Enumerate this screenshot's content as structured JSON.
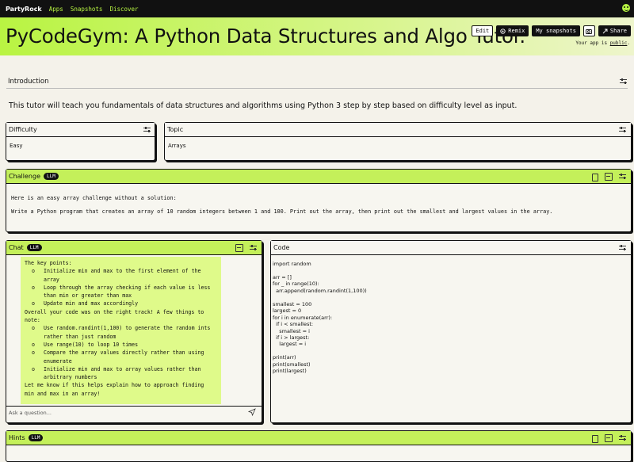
{
  "nav": {
    "brand": "PartyRock",
    "links": [
      "Apps",
      "Snapshots",
      "Discover"
    ]
  },
  "header": {
    "title": "PyCodeGym: A Python Data Structures and Algo Tutor.",
    "buttons": {
      "edit": "Edit",
      "remix": "Remix",
      "snapshots": "My snapshots",
      "share": "Share"
    },
    "public_prefix": "Your app is ",
    "public_link": "public",
    "public_suffix": "."
  },
  "intro": {
    "title": "Introduction",
    "text": "This tutor will teach you fundamentals of data structures and algorithms using Python 3 step by step based on difficulty level as input."
  },
  "difficulty": {
    "title": "Difficulty",
    "value": "Easy"
  },
  "topic": {
    "title": "Topic",
    "value": "Arrays"
  },
  "challenge": {
    "title": "Challenge",
    "badge": "LLM",
    "line1": "Here is an easy array challenge without a solution:",
    "line2": "Write a Python program that creates an array of 10 random integers between 1 and 100. Print out the array, then print out the smallest and largest values in the array."
  },
  "chat": {
    "title": "Chat",
    "badge": "LLM",
    "lines": [
      {
        "indent": 0,
        "text": "The key points:"
      },
      {
        "indent": 1,
        "bullet": "o",
        "text": "Initialize min and max to the first element of the"
      },
      {
        "indent": 2,
        "text": "array"
      },
      {
        "indent": 1,
        "bullet": "o",
        "text": "Loop through the array checking if each value is less"
      },
      {
        "indent": 2,
        "text": "than min or greater than max"
      },
      {
        "indent": 1,
        "bullet": "o",
        "text": "Update min and max accordingly"
      },
      {
        "indent": 0,
        "text": "Overall your code was on the right track! A few things to"
      },
      {
        "indent": 0,
        "text": "note:"
      },
      {
        "indent": 1,
        "bullet": "o",
        "text": "Use random.randint(1,100) to generate the random ints"
      },
      {
        "indent": 2,
        "text": "rather than just random"
      },
      {
        "indent": 1,
        "bullet": "o",
        "text": "Use range(10) to loop 10 times"
      },
      {
        "indent": 1,
        "bullet": "o",
        "text": "Compare the array values directly rather than using"
      },
      {
        "indent": 2,
        "text": "enumerate"
      },
      {
        "indent": 1,
        "bullet": "o",
        "text": "Initialize min and max to array values rather than"
      },
      {
        "indent": 2,
        "text": "arbitrary numbers"
      },
      {
        "indent": 0,
        "text": "Let me know if this helps explain how to approach finding"
      },
      {
        "indent": 0,
        "text": "min and max in an array!"
      }
    ],
    "placeholder": "Ask a question..."
  },
  "code": {
    "title": "Code",
    "text": "import random\n\narr = []\nfor _ in range(10):\n  arr.append(random.randint(1,100))\n\nsmallest = 100\nlargest = 0\nfor i in enumerate(arr):\n  if i < smallest:\n    smallest = i\n  if i > largest:\n    largest = i\n\nprint(arr)\nprint(smallest)\nprint(largest)"
  },
  "hints": {
    "title": "Hints",
    "badge": "LLM"
  },
  "colors": {
    "accent": "#c4f05a",
    "dark": "#111111",
    "background": "#f4f2ea",
    "chat_bubble": "#dffa8a"
  },
  "icons": [
    "smiley-icon",
    "remix-icon",
    "camera-icon",
    "share-icon",
    "settings-sliders-icon",
    "copy-icon",
    "save-icon",
    "send-icon"
  ]
}
